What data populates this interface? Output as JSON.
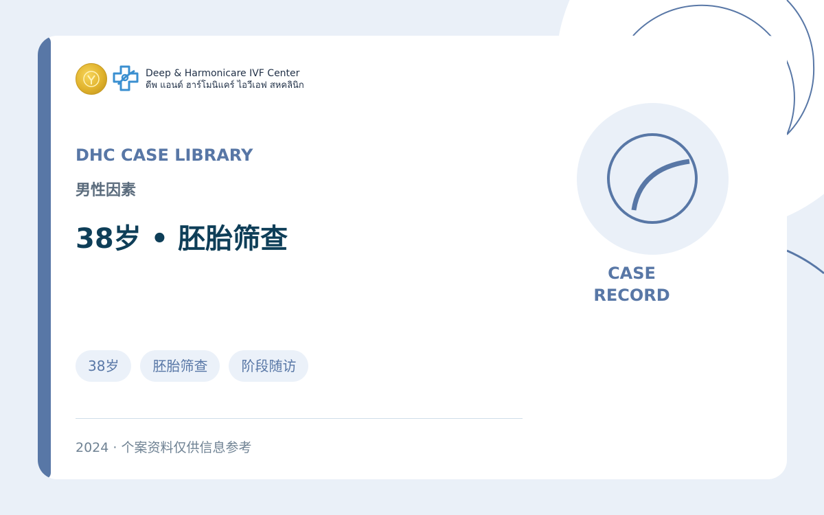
{
  "brand": {
    "name_en": "Deep & Harmonicare IVF Center",
    "name_th": "ดีพ แอนด์ ฮาร์โมนิแคร์ ไอวีเอฟ สหคลินิก"
  },
  "eyebrow": "DHC CASE LIBRARY",
  "category": "男性因素",
  "title": "38岁 • 胚胎筛查",
  "tags": [
    "38岁",
    "胚胎筛查",
    "阶段随访"
  ],
  "footer": "2024 · 个案资料仅供信息参考",
  "badge": {
    "line1": "CASE",
    "line2": "RECORD",
    "icon": "arc-circle-icon"
  },
  "colors": {
    "accent": "#5877a6",
    "title": "#0e3e58",
    "background": "#eaf0f8",
    "card": "#ffffff",
    "seal_gold": "#e0b22c",
    "brand_blue": "#3a8fd0"
  }
}
